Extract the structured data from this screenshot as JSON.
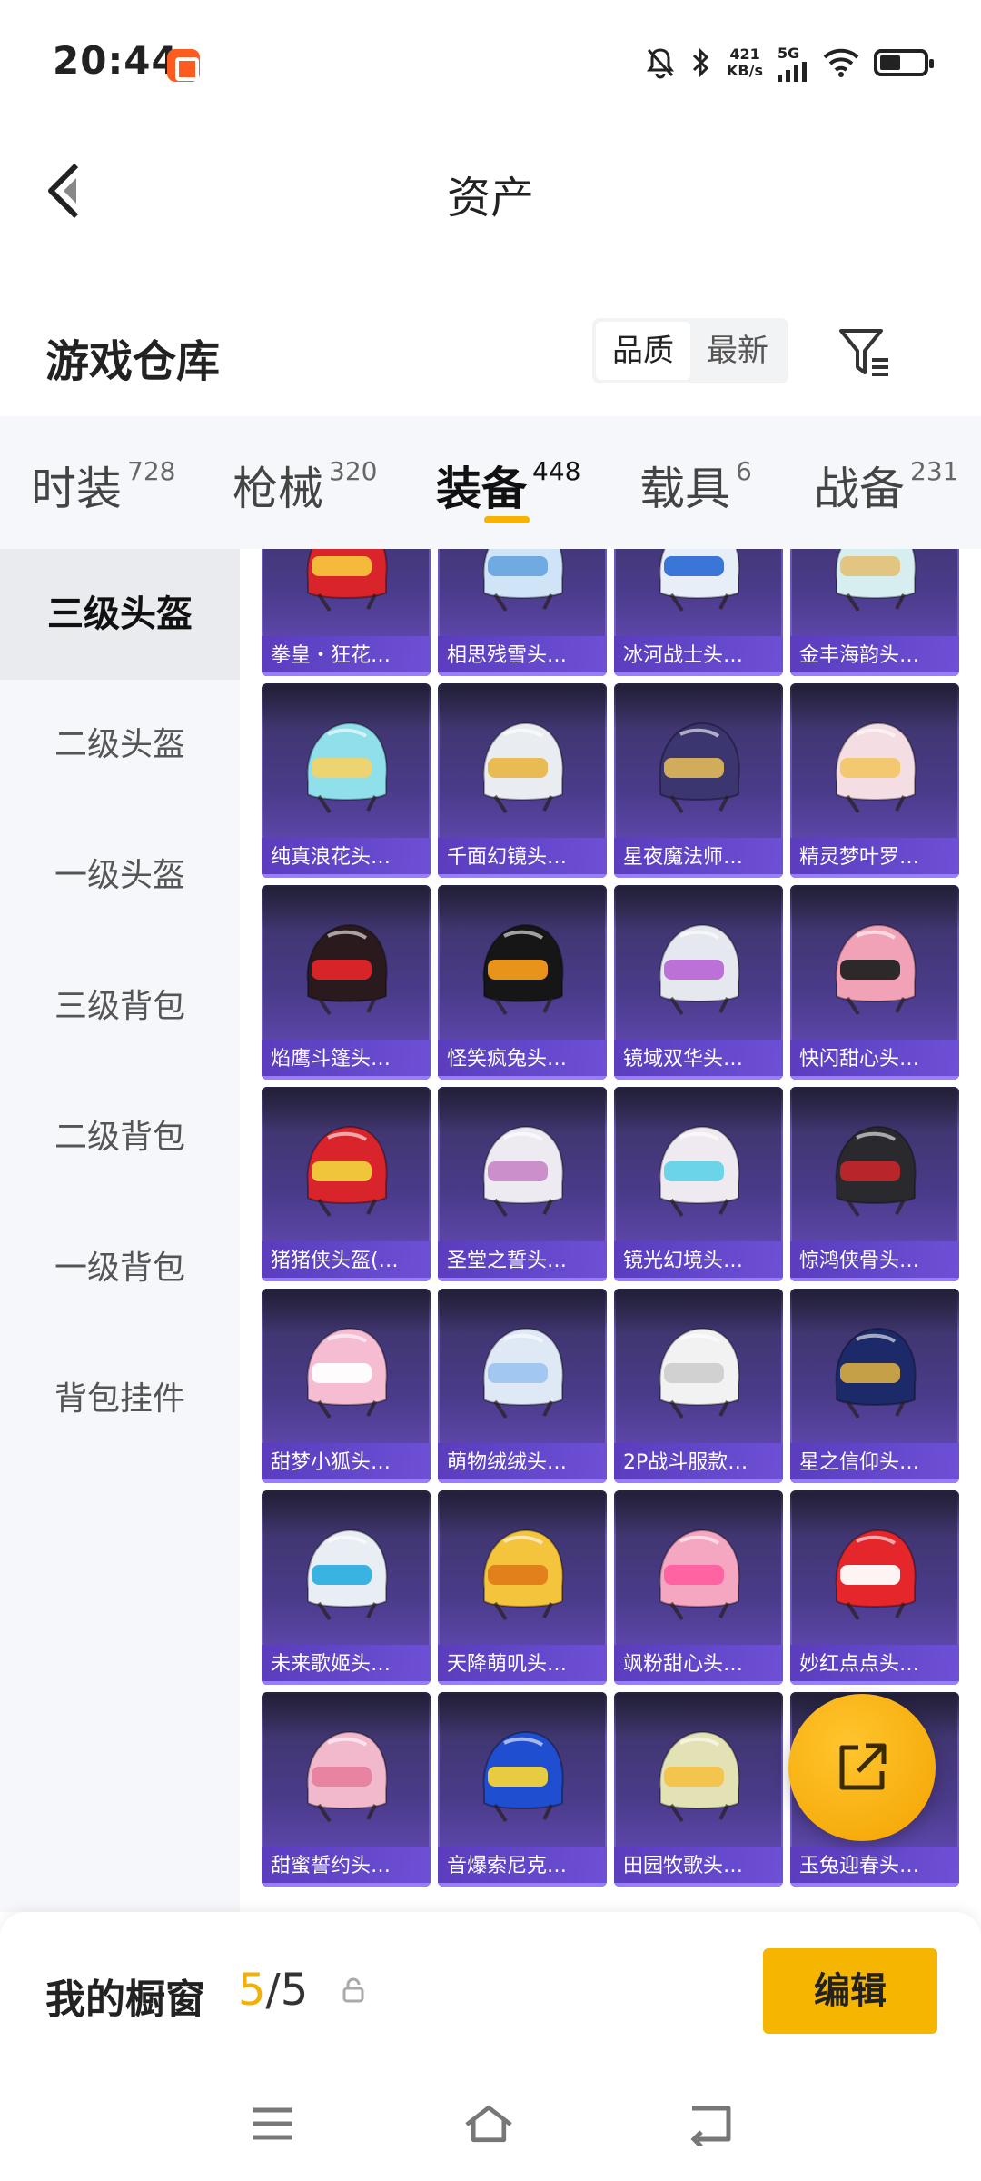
{
  "status_bar": {
    "time": "20:44",
    "net_speed_value": "421",
    "net_speed_unit": "KB/s",
    "signal_label": "5G"
  },
  "header": {
    "title": "资产"
  },
  "section": {
    "title": "游戏仓库",
    "sort_options": [
      "品质",
      "最新"
    ],
    "active_sort": "品质"
  },
  "tabs": [
    {
      "label": "时装",
      "count": "728"
    },
    {
      "label": "枪械",
      "count": "320"
    },
    {
      "label": "装备",
      "count": "448"
    },
    {
      "label": "载具",
      "count": "6"
    },
    {
      "label": "战备",
      "count": "231"
    }
  ],
  "active_tab": "装备",
  "categories": [
    "三级头盔",
    "二级头盔",
    "一级头盔",
    "三级背包",
    "二级背包",
    "一级背包",
    "背包挂件"
  ],
  "active_category": "三级头盔",
  "items": [
    {
      "name": "拳皇・狂花…",
      "color": "#d8242a",
      "accent": "#f7c23c"
    },
    {
      "name": "相思残雪头…",
      "color": "#cfe4f6",
      "accent": "#6aa7e0"
    },
    {
      "name": "冰河战士头…",
      "color": "#e8eef7",
      "accent": "#2f6fd6"
    },
    {
      "name": "金丰海韵头…",
      "color": "#d6eef0",
      "accent": "#e3c27a"
    },
    {
      "name": "纯真浪花头…",
      "color": "#8fe0ea",
      "accent": "#f1d36a"
    },
    {
      "name": "千面幻镜头…",
      "color": "#e9edf2",
      "accent": "#e9b84a"
    },
    {
      "name": "星夜魔法师…",
      "color": "#3b3570",
      "accent": "#d9b45a"
    },
    {
      "name": "精灵梦叶罗…",
      "color": "#f4dde3",
      "accent": "#f1c66a"
    },
    {
      "name": "焰鹰斗篷头…",
      "color": "#2a1a1e",
      "accent": "#e0252a"
    },
    {
      "name": "怪笑疯兔头…",
      "color": "#161616",
      "accent": "#f39a1a"
    },
    {
      "name": "镜域双华头…",
      "color": "#e6e8ef",
      "accent": "#b96ad6"
    },
    {
      "name": "快闪甜心头…",
      "color": "#f2a2b6",
      "accent": "#222222"
    },
    {
      "name": "猪猪侠头盔(…",
      "color": "#d8242a",
      "accent": "#f2cf3a"
    },
    {
      "name": "圣堂之誓头…",
      "color": "#eeeaf2",
      "accent": "#c88ac9"
    },
    {
      "name": "镜光幻境头…",
      "color": "#efe9f0",
      "accent": "#63d3e8"
    },
    {
      "name": "惊鸿侠骨头…",
      "color": "#2a2a2e",
      "accent": "#c0262b"
    },
    {
      "name": "甜梦小狐头…",
      "color": "#f6bcd2",
      "accent": "#ffffff"
    },
    {
      "name": "萌物绒绒头…",
      "color": "#dfe9f6",
      "accent": "#9ec6f0"
    },
    {
      "name": "2P战斗服款…",
      "color": "#f2f2f2",
      "accent": "#cfcfcf"
    },
    {
      "name": "星之信仰头…",
      "color": "#1c2a6a",
      "accent": "#d0a744"
    },
    {
      "name": "未来歌姬头…",
      "color": "#e9eef4",
      "accent": "#2fb0e0"
    },
    {
      "name": "天降萌叽头…",
      "color": "#f4c43c",
      "accent": "#e07d1a"
    },
    {
      "name": "飒粉甜心头…",
      "color": "#f5a6c1",
      "accent": "#ff5fa0"
    },
    {
      "name": "妙红点点头…",
      "color": "#e5262b",
      "accent": "#ffffff"
    },
    {
      "name": "甜蜜誓约头…",
      "color": "#f2b9cd",
      "accent": "#e8809f"
    },
    {
      "name": "音爆索尼克…",
      "color": "#1f4fd0",
      "accent": "#f2d23a"
    },
    {
      "name": "田园牧歌头…",
      "color": "#e3e2b5",
      "accent": "#f3c34a"
    },
    {
      "name": "玉兔迎春头…",
      "color": "#eef0f4",
      "accent": "#d8263a"
    }
  ],
  "showcase": {
    "label": "我的橱窗",
    "current": "5",
    "total": "/5",
    "edit_label": "编辑"
  }
}
